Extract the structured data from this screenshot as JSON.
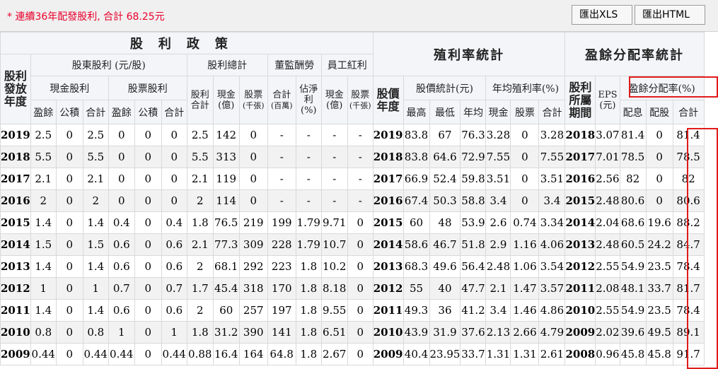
{
  "note": "* 連續36年配發股利, 合計 68.25元",
  "buttons": {
    "xls": "匯出XLS",
    "html": "匯出HTML"
  },
  "colors": {
    "accent_red": "#e01b1b",
    "note_red": "#e8002a"
  },
  "header": {
    "group_policy": "股利政策",
    "group_yield": "殖利率統計",
    "group_payout": "盈餘分配率統計",
    "year_label": "股利發放年度",
    "shareholder": "股東股利 (元/股)",
    "total_div": "股利總計",
    "director": "董監酬勞",
    "employee": "員工紅利",
    "cash_div": "現金股利",
    "stock_div": "股票股利",
    "div_total": "股利合計",
    "price_year": "股價年度",
    "price_stats": "股價統計(元)",
    "avg_yield": "年均殖利率(%)",
    "period": "股利所屬期間",
    "eps": "EPS (元)",
    "payout_rate": "盈餘分配率(%)",
    "earnings": "盈餘",
    "capital": "公積",
    "total": "合計",
    "cash_amt": "現金 (億)",
    "stock_amt": "股票",
    "stock_unit": "(千張)",
    "dir_total": "合計",
    "dir_unit": "(百萬)",
    "net_ratio": "佔淨利 (%)",
    "high": "最高",
    "low": "最低",
    "avg": "年均",
    "cash": "現金",
    "stock": "股票",
    "sum": "合計",
    "pay_cash": "配息",
    "pay_stock": "配股"
  },
  "rows": [
    [
      "2019",
      "2.5",
      "0",
      "2.5",
      "0",
      "0",
      "0",
      "2.5",
      "142",
      "0",
      "-",
      "-",
      "-",
      "-",
      "2019",
      "83.8",
      "67",
      "76.3",
      "3.28",
      "0",
      "3.28",
      "2018",
      "3.07",
      "81.4",
      "0",
      "81.4"
    ],
    [
      "2018",
      "5.5",
      "0",
      "5.5",
      "0",
      "0",
      "0",
      "5.5",
      "313",
      "0",
      "-",
      "-",
      "-",
      "-",
      "2018",
      "83.8",
      "64.6",
      "72.9",
      "7.55",
      "0",
      "7.55",
      "2017",
      "7.01",
      "78.5",
      "0",
      "78.5"
    ],
    [
      "2017",
      "2.1",
      "0",
      "2.1",
      "0",
      "0",
      "0",
      "2.1",
      "119",
      "0",
      "-",
      "-",
      "-",
      "-",
      "2017",
      "66.9",
      "52.4",
      "59.8",
      "3.51",
      "0",
      "3.51",
      "2016",
      "2.56",
      "82",
      "0",
      "82"
    ],
    [
      "2016",
      "2",
      "0",
      "2",
      "0",
      "0",
      "0",
      "2",
      "114",
      "0",
      "-",
      "-",
      "-",
      "-",
      "2016",
      "67.4",
      "50.3",
      "58.8",
      "3.4",
      "0",
      "3.4",
      "2015",
      "2.48",
      "80.6",
      "0",
      "80.6"
    ],
    [
      "2015",
      "1.4",
      "0",
      "1.4",
      "0.4",
      "0",
      "0.4",
      "1.8",
      "76.5",
      "219",
      "199",
      "1.79",
      "9.71",
      "0",
      "2015",
      "60",
      "48",
      "53.9",
      "2.6",
      "0.74",
      "3.34",
      "2014",
      "2.04",
      "68.6",
      "19.6",
      "88.2"
    ],
    [
      "2014",
      "1.5",
      "0",
      "1.5",
      "0.6",
      "0",
      "0.6",
      "2.1",
      "77.3",
      "309",
      "228",
      "1.79",
      "10.7",
      "0",
      "2014",
      "58.6",
      "46.7",
      "51.8",
      "2.9",
      "1.16",
      "4.06",
      "2013",
      "2.48",
      "60.5",
      "24.2",
      "84.7"
    ],
    [
      "2013",
      "1.4",
      "0",
      "1.4",
      "0.6",
      "0",
      "0.6",
      "2",
      "68.1",
      "292",
      "223",
      "1.8",
      "10.2",
      "0",
      "2013",
      "68.3",
      "49.6",
      "56.4",
      "2.48",
      "1.06",
      "3.54",
      "2012",
      "2.55",
      "54.9",
      "23.5",
      "78.4"
    ],
    [
      "2012",
      "1",
      "0",
      "1",
      "0.7",
      "0",
      "0.7",
      "1.7",
      "45.4",
      "318",
      "170",
      "1.8",
      "8.18",
      "0",
      "2012",
      "55",
      "40",
      "47.7",
      "2.1",
      "1.47",
      "3.57",
      "2011",
      "2.08",
      "48.1",
      "33.7",
      "81.7"
    ],
    [
      "2011",
      "1.4",
      "0",
      "1.4",
      "0.6",
      "0",
      "0.6",
      "2",
      "60",
      "257",
      "197",
      "1.8",
      "9.55",
      "0",
      "2011",
      "49.3",
      "36",
      "41.2",
      "3.4",
      "1.46",
      "4.86",
      "2010",
      "2.55",
      "54.9",
      "23.5",
      "78.4"
    ],
    [
      "2010",
      "0.8",
      "0",
      "0.8",
      "1",
      "0",
      "1",
      "1.8",
      "31.2",
      "390",
      "141",
      "1.8",
      "6.51",
      "0",
      "2010",
      "43.9",
      "31.9",
      "37.6",
      "2.13",
      "2.66",
      "4.79",
      "2009",
      "2.02",
      "39.6",
      "49.5",
      "89.1"
    ],
    [
      "2009",
      "0.44",
      "0",
      "0.44",
      "0.44",
      "0",
      "0.44",
      "0.88",
      "16.4",
      "164",
      "64.8",
      "1.8",
      "2.67",
      "0",
      "2009",
      "40.4",
      "23.95",
      "33.7",
      "1.31",
      "1.31",
      "2.61",
      "2008",
      "0.96",
      "45.8",
      "45.8",
      "91.7"
    ]
  ]
}
